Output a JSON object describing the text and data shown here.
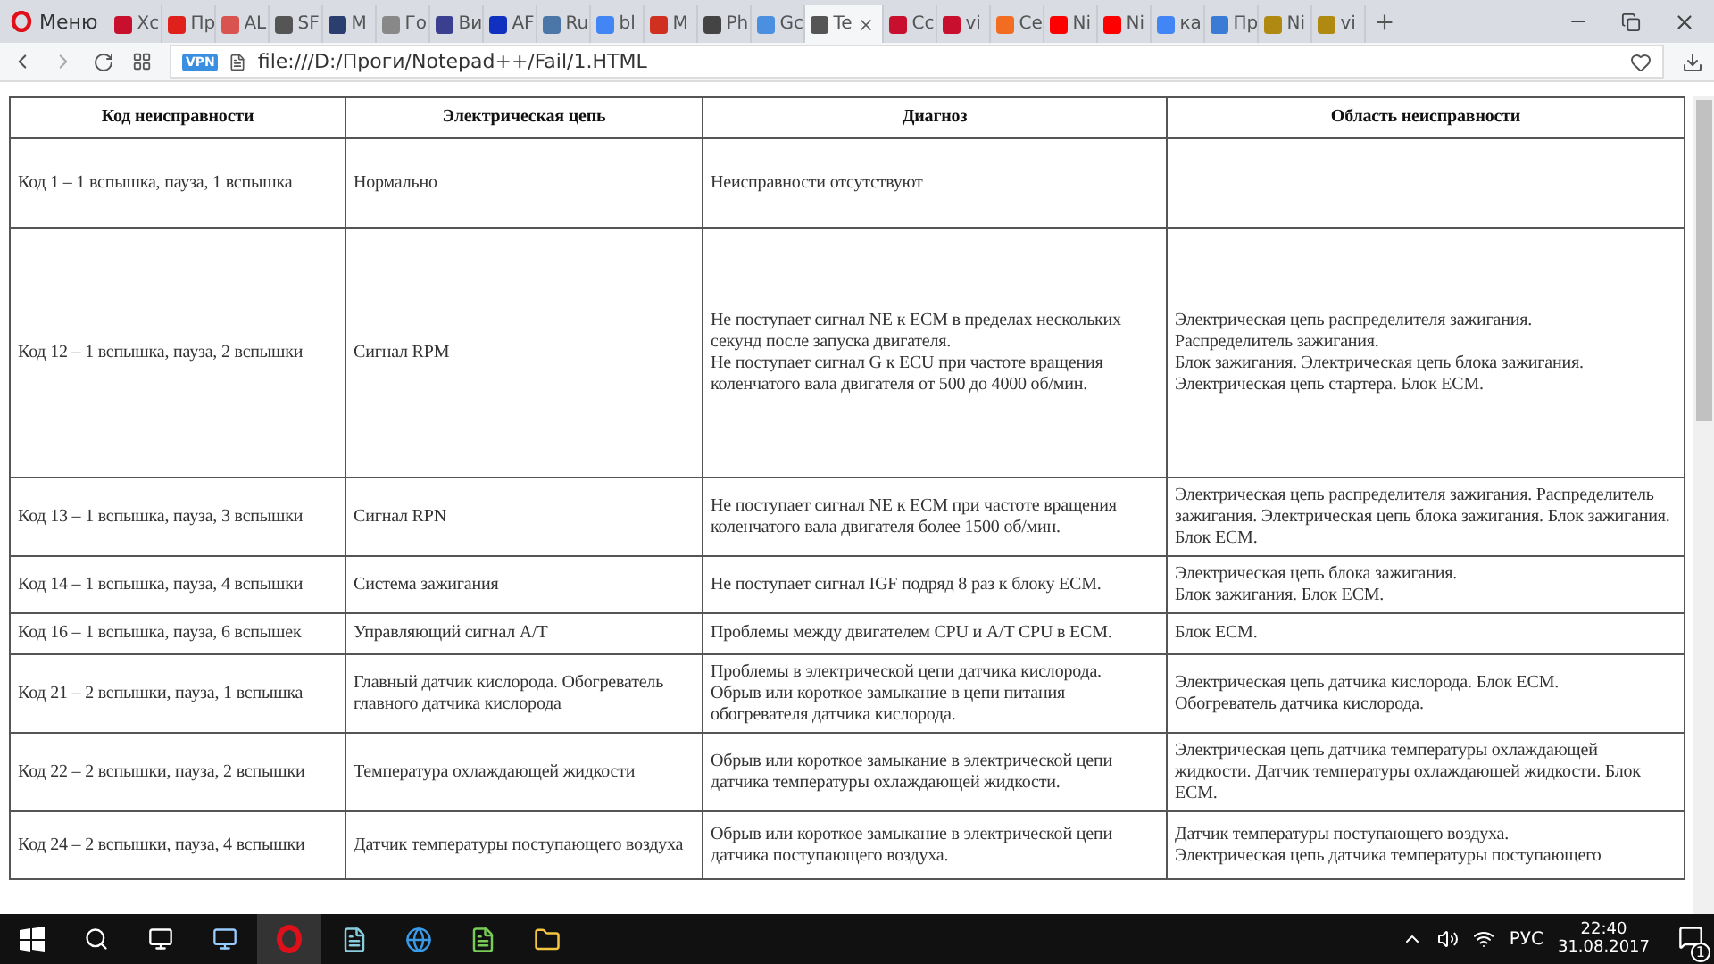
{
  "browser": {
    "menu_label": "Меню",
    "tabs": [
      {
        "label": "Xc",
        "selected": false,
        "color": "#c8102e"
      },
      {
        "label": "Пр",
        "selected": false,
        "color": "#e0201a"
      },
      {
        "label": "AL",
        "selected": false,
        "color": "#d9534f"
      },
      {
        "label": "SF",
        "selected": false,
        "color": "#555555"
      },
      {
        "label": "M",
        "selected": false,
        "color": "#2a3f6e"
      },
      {
        "label": "Го",
        "selected": false,
        "color": "#888888"
      },
      {
        "label": "Ви",
        "selected": false,
        "color": "#3b3f8f"
      },
      {
        "label": "AF",
        "selected": false,
        "color": "#1030c0"
      },
      {
        "label": "Ru",
        "selected": false,
        "color": "#4a76a8"
      },
      {
        "label": "bl",
        "selected": false,
        "color": "#4285f4"
      },
      {
        "label": "M",
        "selected": false,
        "color": "#d03020"
      },
      {
        "label": "Ph",
        "selected": false,
        "color": "#444444"
      },
      {
        "label": "Gc",
        "selected": false,
        "color": "#4a8fe0"
      },
      {
        "label": "Te",
        "selected": true,
        "color": "#555555"
      },
      {
        "label": "Cc",
        "selected": false,
        "color": "#c8102e"
      },
      {
        "label": "vi",
        "selected": false,
        "color": "#c8102e"
      },
      {
        "label": "Ce",
        "selected": false,
        "color": "#f26c22"
      },
      {
        "label": "Ni",
        "selected": false,
        "color": "#ff0000"
      },
      {
        "label": "Ni",
        "selected": false,
        "color": "#ff0000"
      },
      {
        "label": "ка",
        "selected": false,
        "color": "#4285f4"
      },
      {
        "label": "Пр",
        "selected": false,
        "color": "#3a7bd5"
      },
      {
        "label": "Ni",
        "selected": false,
        "color": "#b08a10"
      },
      {
        "label": "vi",
        "selected": false,
        "color": "#b08a10"
      }
    ],
    "vpn_label": "VPN",
    "url": "file:///D:/Проги/Notepad++/Fail/1.HTML"
  },
  "table": {
    "columns": [
      "Код неисправности",
      "Электрическая цепь",
      "Диагноз",
      "Область неисправности"
    ],
    "rows": [
      [
        "Код 1 – 1 вспышка, пауза, 1 вспышка",
        "Нормально",
        "Неисправности отсутствуют",
        ""
      ],
      [
        "Код 12 – 1 вспышка, пауза, 2 вспышки",
        "Сигнал RPM",
        "Не поступает сигнал NE к ECM в пределах нескольких секунд после запуска двигателя.\nНе поступает сигнал G к ECU при частоте вращения коленчатого вала двигателя от 500 до 4000 об/мин.",
        "Электрическая цепь распределителя зажигания.\nРаспределитель зажигания.\nБлок зажигания. Электрическая цепь блока зажигания.\nЭлектрическая цепь стартера. Блок ECM."
      ],
      [
        "Код 13 – 1 вспышка, пауза, 3 вспышки",
        "Сигнал RPN",
        "Не поступает сигнал NE к ECM при частоте вращения коленчатого вала двигателя более 1500 об/мин.",
        "Электрическая цепь распределителя зажигания. Распределитель зажигания. Электрическая цепь блока зажигания. Блок зажигания. Блок ECM."
      ],
      [
        "Код 14 – 1 вспышка, пауза, 4 вспышки",
        "Система зажигания",
        "Не поступает сигнал IGF подряд 8 раз к блоку ECM.",
        "Электрическая цепь блока зажигания.\nБлок зажигания. Блок ECM."
      ],
      [
        "Код 16 – 1 вспышка, пауза, 6 вспышек",
        "Управляющий сигнал A/T",
        "Проблемы между двигателем CPU и A/T CPU в ECM.",
        "Блок ECM."
      ],
      [
        "Код 21 – 2 вспышки, пауза, 1 вспышка",
        "Главный датчик кислорода. Обогреватель главного датчика кислорода",
        "Проблемы в электрической цепи датчика кислорода.\nОбрыв или короткое замыкание в цепи питания обогревателя датчика кислорода.",
        "Электрическая цепь датчика кислорода. Блок ECM.\nОбогреватель датчика кислорода."
      ],
      [
        "Код 22 – 2 вспышки, пауза, 2 вспышки",
        "Температура охлаждающей жидкости",
        "Обрыв или короткое замыкание в электрической цепи датчика температуры охлаждающей жидкости.",
        "Электрическая цепь датчика температуры охлаждающей жидкости. Датчик температуры охлаждающей жидкости. Блок ECM."
      ],
      [
        "Код 24 – 2 вспышки, пауза, 4 вспышки",
        "Датчик температуры поступающего воздуха",
        "Обрыв или короткое замыкание в электрической цепи датчика поступающего воздуха.",
        "Датчик температуры поступающего воздуха.\nЭлектрическая цепь датчика температуры поступающего"
      ]
    ]
  },
  "taskbar": {
    "language": "РУС",
    "time": "22:40",
    "date": "31.08.2017",
    "notifications": "1"
  }
}
